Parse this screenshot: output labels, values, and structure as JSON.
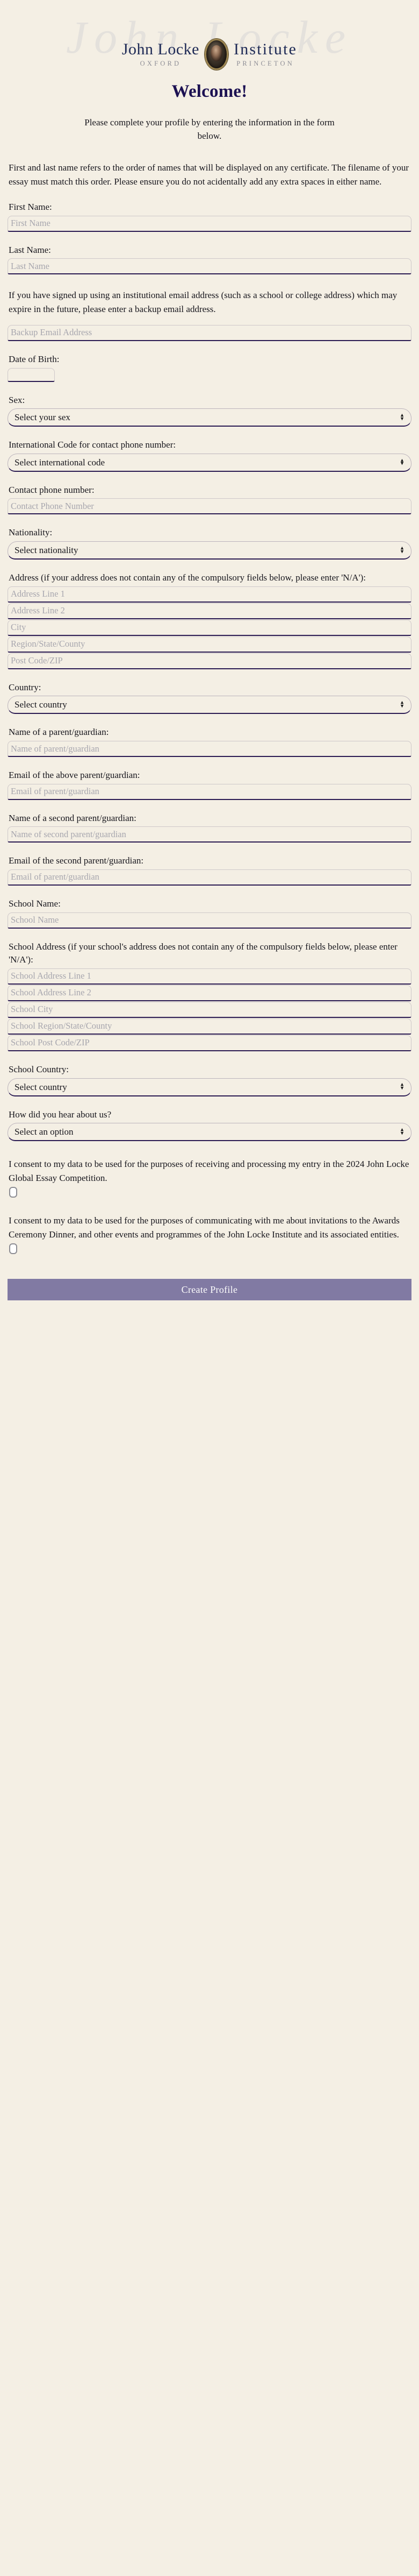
{
  "brand": {
    "name_left": "John Locke",
    "name_right": "Institute",
    "sub_left": "OXFORD",
    "sub_right": "PRINCETON",
    "watermark": "John Locke",
    "navy": "#1e2a55",
    "gold": "#9b8450"
  },
  "header": {
    "welcome": "Welcome!",
    "intro": "Please complete your profile by entering the information in the form below."
  },
  "form": {
    "name_blurb": "First and last name refers to the order of names that will be displayed on any certificate. The filename of your essay must match this order. Please ensure you do not acidentally add any extra spaces in either name.",
    "first_name_label": "First Name:",
    "first_name_placeholder": "First Name",
    "last_name_label": "Last Name:",
    "last_name_placeholder": "Last Name",
    "backup_email_blurb": "If you have signed up using an institutional email address (such as a school or college address) which may expire in the future, please enter a backup email address.",
    "backup_email_placeholder": "Backup Email Address",
    "dob_label": "Date of Birth:",
    "dob_value": "",
    "sex_label": "Sex:",
    "sex_selected": "Select your sex",
    "intl_code_label": "International Code for contact phone number:",
    "intl_code_selected": "Select international code",
    "phone_label": "Contact phone number:",
    "phone_placeholder": "Contact Phone Number",
    "nationality_label": "Nationality:",
    "nationality_selected": "Select nationality",
    "address_label": "Address (if your address does not contain any of the compulsory fields below, please enter 'N/A'):",
    "address_line1_placeholder": "Address Line 1",
    "address_line2_placeholder": "Address Line 2",
    "city_placeholder": "City",
    "region_placeholder": "Region/State/County",
    "postcode_placeholder": "Post Code/ZIP",
    "country_label": "Country:",
    "country_selected": "Select country",
    "parent_name_label": "Name of a parent/guardian:",
    "parent_name_placeholder": "Name of parent/guardian",
    "parent_email_label": "Email of the above parent/guardian:",
    "parent_email_placeholder": "Email of parent/guardian",
    "parent2_name_label": "Name of a second parent/guardian:",
    "parent2_name_placeholder": "Name of second parent/guardian",
    "parent2_email_label": "Email of the second parent/guardian:",
    "parent2_email_placeholder": "Email of parent/guardian",
    "school_name_label": "School Name:",
    "school_name_placeholder": "School Name",
    "school_address_label": "School Address (if your school's address does not contain any of the compulsory fields below, please enter 'N/A'):",
    "school_line1_placeholder": "School Address Line 1",
    "school_line2_placeholder": "School Address Line 2",
    "school_city_placeholder": "School City",
    "school_region_placeholder": "School Region/State/County",
    "school_postcode_placeholder": "School Post Code/ZIP",
    "school_country_label": "School Country:",
    "school_country_selected": "Select country",
    "hear_about_label": "How did you hear about us?",
    "hear_about_selected": "Select an option"
  },
  "consent": {
    "first": "I consent to my data to be used for the purposes of receiving and processing my entry in the 2024 John Locke Global Essay Competition.",
    "second": "I consent to my data to be used for the purposes of communicating with me about invitations to the Awards Ceremony Dinner, and other events and programmes of the John Locke Institute and its associated entities."
  },
  "submit": {
    "label": "Create Profile",
    "color": "#817aa3"
  },
  "icons": {
    "chevron_up": "▴",
    "chevron_down": "▾"
  }
}
